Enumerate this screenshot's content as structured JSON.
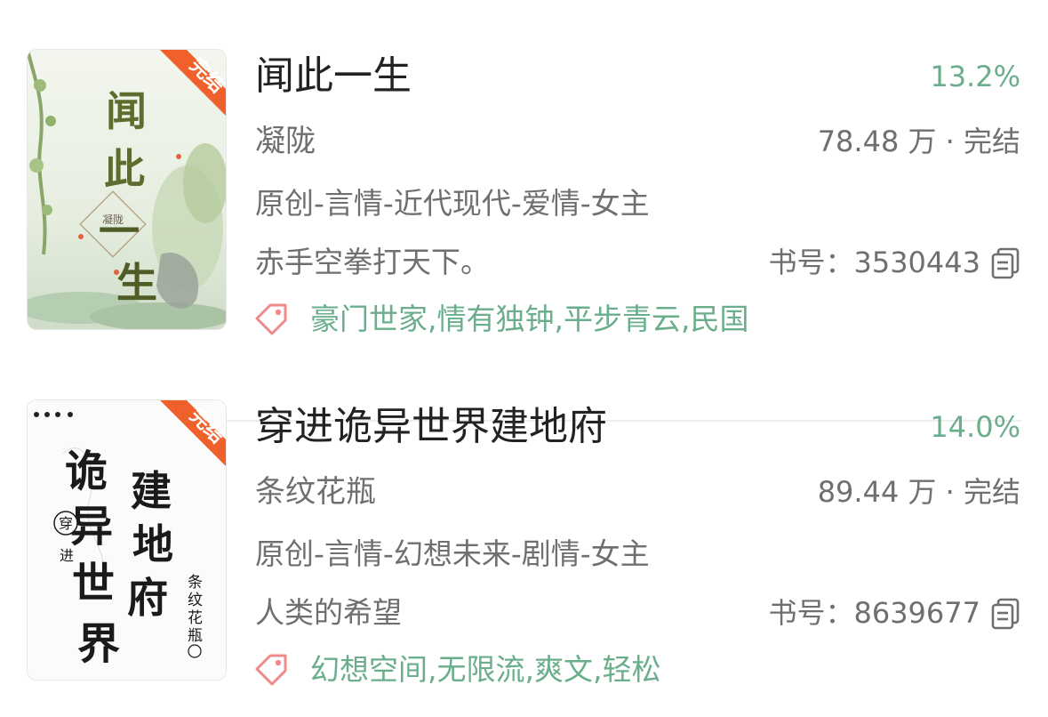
{
  "books": [
    {
      "cover_badge": "完结",
      "cover_title": "闻此一生",
      "cover_author": "凝陇",
      "title": "闻此一生",
      "percent": "13.2%",
      "author": "凝陇",
      "stats": "78.48 万 · 完结",
      "category": "原创-言情-近代现代-爱情-女主",
      "intro": "赤手空拳打天下。",
      "book_id": "书号：3530443",
      "tags": "豪门世家,情有独钟,平步青云,民国"
    },
    {
      "cover_badge": "完结",
      "cover_title": "诡异世界建地府",
      "cover_subtitle": "穿进",
      "cover_author": "条纹花瓶",
      "title": "穿进诡异世界建地府",
      "percent": "14.0%",
      "author": "条纹花瓶",
      "stats": "89.44 万 · 完结",
      "category": "原创-言情-幻想未来-剧情-女主",
      "intro": "人类的希望",
      "book_id": "书号：8639677",
      "tags": "幻想空间,无限流,爽文,轻松"
    }
  ],
  "colors": {
    "accent_green": "#6aae8c",
    "badge_orange": "#f0602a",
    "tag_icon_red": "#f08a8a",
    "text_primary": "#222222",
    "text_secondary": "#6f6f6f"
  },
  "icons": {
    "copy": "copy-icon",
    "tag": "tag-icon"
  }
}
